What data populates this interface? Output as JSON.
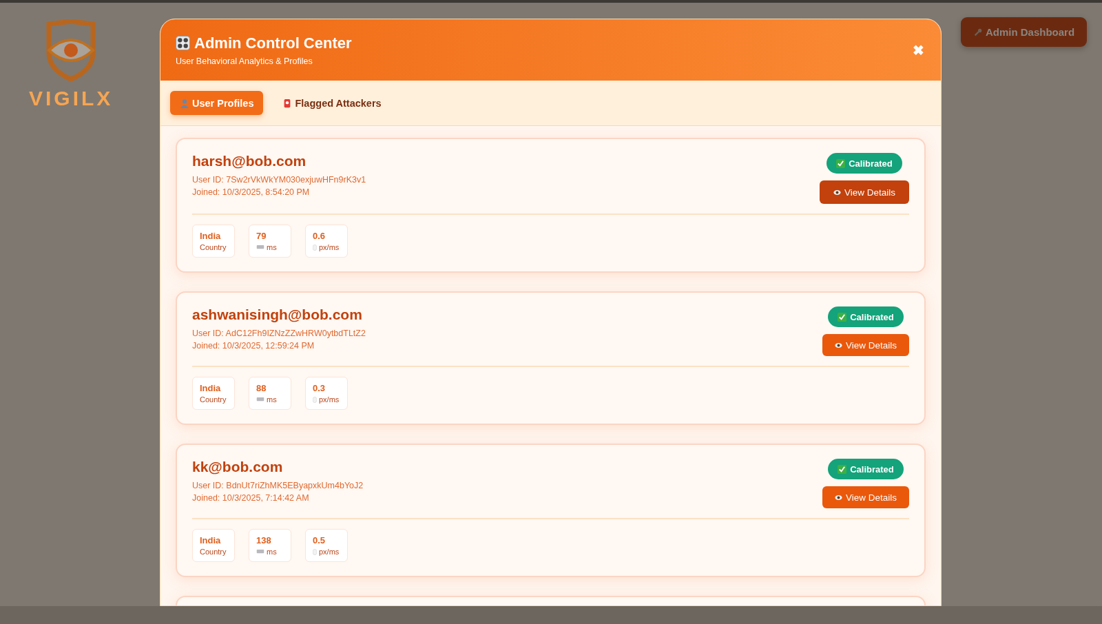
{
  "page": {
    "logo_text": "VIGILX",
    "admin_button": "Admin Dashboard"
  },
  "modal": {
    "title": "Admin Control Center",
    "subtitle": "User Behavioral Analytics & Profiles",
    "close": "✖",
    "tabs": [
      {
        "label": "User Profiles",
        "kind": "user",
        "selected": true
      },
      {
        "label": "Flagged Attackers",
        "kind": "siren",
        "selected": false
      }
    ],
    "users": [
      {
        "email": "harsh@bob.com",
        "user_id": "User ID: 7Sw2rVkWkYM030exjuwHFn9rK3v1",
        "joined": "Joined: 10/3/2025, 8:54:20 PM",
        "status": "Calibrated",
        "calibrated": true,
        "button": "View Details",
        "highlighted": true,
        "stats": [
          {
            "kind": "country",
            "value": "India",
            "label": "Country"
          },
          {
            "kind": "keyboard",
            "value": "79",
            "label": "ms"
          },
          {
            "kind": "mouse",
            "value": "0.6",
            "label": "px/ms"
          }
        ]
      },
      {
        "email": "ashwanisingh@bob.com",
        "user_id": "User ID: AdC12Fh9IZNzZZwHRW0ytbdTLtZ2",
        "joined": "Joined: 10/3/2025, 12:59:24 PM",
        "status": "Calibrated",
        "calibrated": true,
        "button": "View Details",
        "highlighted": false,
        "stats": [
          {
            "kind": "country",
            "value": "India",
            "label": "Country"
          },
          {
            "kind": "keyboard",
            "value": "88",
            "label": "ms"
          },
          {
            "kind": "mouse",
            "value": "0.3",
            "label": "px/ms"
          }
        ]
      },
      {
        "email": "kk@bob.com",
        "user_id": "User ID: BdnUt7riZhMK5EByapxkUm4bYoJ2",
        "joined": "Joined: 10/3/2025, 7:14:42 AM",
        "status": "Calibrated",
        "calibrated": true,
        "button": "View Details",
        "highlighted": false,
        "stats": [
          {
            "kind": "country",
            "value": "India",
            "label": "Country"
          },
          {
            "kind": "keyboard",
            "value": "138",
            "label": "ms"
          },
          {
            "kind": "mouse",
            "value": "0.5",
            "label": "px/ms"
          }
        ]
      }
    ]
  }
}
